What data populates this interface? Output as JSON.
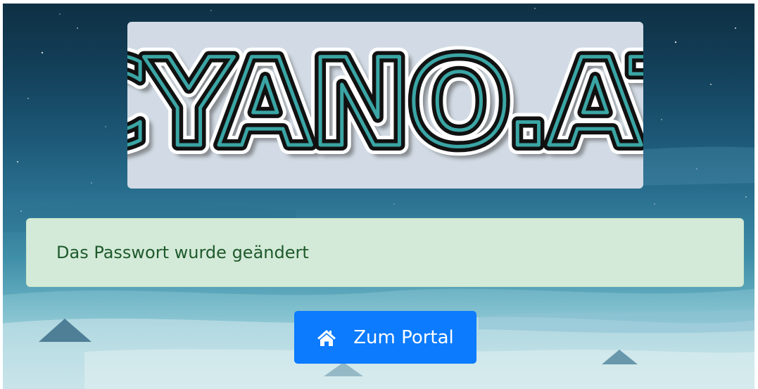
{
  "logo": {
    "text": "CYANO.AT",
    "colors": {
      "card_bg": "#d2dbe5",
      "stroke_dark": "#111111",
      "stroke_cyan": "#3aa5a4"
    }
  },
  "alert": {
    "message": "Das Passwort wurde geändert",
    "colors": {
      "bg": "#d4ead8",
      "text": "#1e5a2c"
    }
  },
  "portal_button": {
    "label": "Zum Portal",
    "icon": "home-icon",
    "color": "#0c7bfd"
  }
}
